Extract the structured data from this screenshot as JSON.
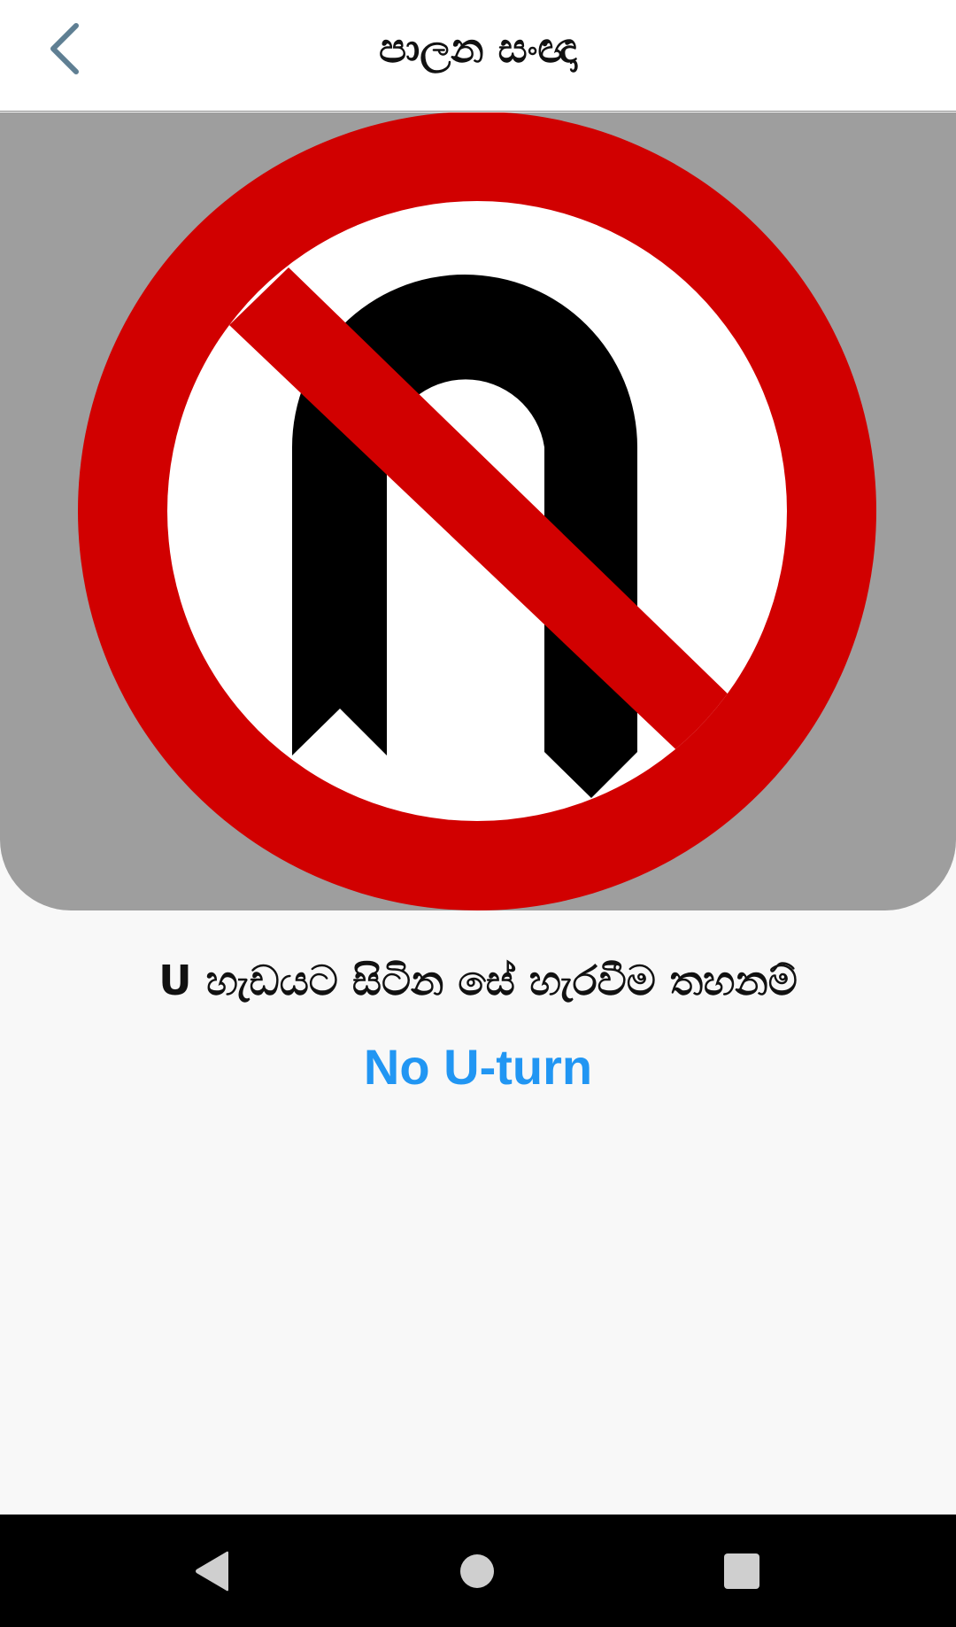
{
  "app_bar": {
    "title": "පාලන සංඥා",
    "back_icon": "chevron-left-icon",
    "back_icon_color": "#5f7f93"
  },
  "sign": {
    "icon": "no-u-turn-sign",
    "name_sinhala": "U හැඩයට සිටින සේ හැරවීම තහනම්",
    "name_english": "No U-turn",
    "ring_color": "#d10000",
    "symbol_color": "#000000",
    "panel_color": "#9e9e9e",
    "english_color": "#2196f3"
  },
  "nav_bar": {
    "back_icon": "nav-back-icon",
    "home_icon": "nav-home-icon",
    "recents_icon": "nav-recents-icon"
  }
}
